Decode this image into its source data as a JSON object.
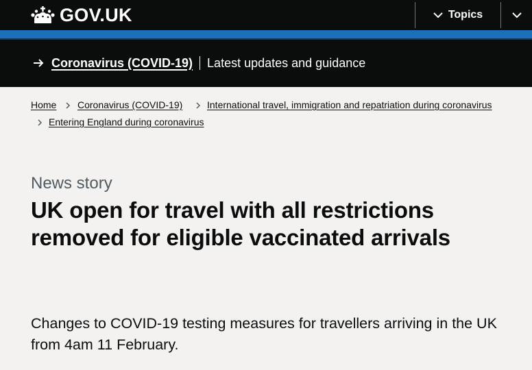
{
  "header": {
    "logo_text": "GOV.UK",
    "topics_label": "Topics"
  },
  "banner": {
    "link_label": "Coronavirus (COVID-19)",
    "subtitle": "Latest updates and guidance"
  },
  "breadcrumbs": [
    {
      "label": "Home"
    },
    {
      "label": "Coronavirus (COVID-19)"
    },
    {
      "label": "International travel, immigration and repatriation during coronavirus"
    },
    {
      "label": "Entering England during coronavirus"
    }
  ],
  "article": {
    "type": "News story",
    "title": "UK open for travel with all restrictions removed for eligible vaccinated arrivals",
    "lead": "Changes to COVID-19 testing measures for travellers arriving in the UK from 4am 11 February."
  },
  "colors": {
    "header_bg": "#0b0c0c",
    "brand_blue": "#1d70b8",
    "page_bg": "#f3f2f1",
    "text": "#0b0c0c",
    "secondary_text": "#505a5f"
  },
  "icons": {
    "logo": "crown-icon",
    "topics": "chevron-down-icon",
    "search_toggle": "chevron-down-icon",
    "banner": "arrow-right-icon",
    "breadcrumb_separator": "chevron-right-icon"
  }
}
